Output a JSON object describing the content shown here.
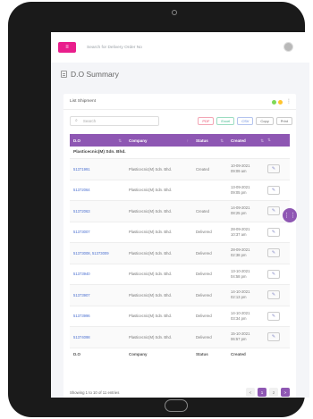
{
  "topbar": {
    "menu_icon": "menu-icon",
    "search_placeholder": "Search for Delivery Order No"
  },
  "page": {
    "title": "D.O Summary"
  },
  "card": {
    "title": "List Shipment",
    "search_placeholder": "Search",
    "export_buttons": [
      "PDF",
      "Excel",
      "CSV",
      "Copy",
      "Print"
    ],
    "status_colors": {
      "green": "#7ed957",
      "yellow": "#ffc42e"
    }
  },
  "table": {
    "columns": {
      "do": "D.O",
      "company": "Company",
      "status": "Status",
      "created": "Created"
    },
    "group": "Plasticecnic(M) Sdn. Bhd.",
    "rows": [
      {
        "do": "51371991",
        "company": "Plasticecnic(M) Sdn. Bhd.",
        "status": "Created",
        "date": "10-09-2021",
        "time": "09:09 am"
      },
      {
        "do": "51372064",
        "company": "Plasticecnic(M) Sdn. Bhd.",
        "status": "",
        "date": "13-09-2021",
        "time": "09:05 pm"
      },
      {
        "do": "51372063",
        "company": "Plasticecnic(M) Sdn. Bhd.",
        "status": "Created",
        "date": "14-09-2021",
        "time": "08:25 pm"
      },
      {
        "do": "51373007",
        "company": "Plasticecnic(M) Sdn. Bhd.",
        "status": "Delivered",
        "date": "28-09-2021",
        "time": "10:37 am"
      },
      {
        "do": "51373008, 51373009",
        "company": "Plasticecnic(M) Sdn. Bhd.",
        "status": "Delivered",
        "date": "28-09-2021",
        "time": "02:38 pm"
      },
      {
        "do": "51373940",
        "company": "Plasticecnic(M) Sdn. Bhd.",
        "status": "Delivered",
        "date": "13-10-2021",
        "time": "04:58 pm"
      },
      {
        "do": "51373907",
        "company": "Plasticecnic(M) Sdn. Bhd.",
        "status": "Delivered",
        "date": "14-10-2021",
        "time": "02:13 pm"
      },
      {
        "do": "51373996",
        "company": "Plasticecnic(M) Sdn. Bhd.",
        "status": "Delivered",
        "date": "14-10-2021",
        "time": "03:34 pm"
      },
      {
        "do": "51374098",
        "company": "Plasticecnic(M) Sdn. Bhd.",
        "status": "Delivered",
        "date": "15-10-2021",
        "time": "06:57 pm"
      }
    ]
  },
  "footer": {
    "showing": "Showing 1 to 10 of 11 entries",
    "pages": [
      "1",
      "2"
    ],
    "prev": "<",
    "next": ">"
  }
}
